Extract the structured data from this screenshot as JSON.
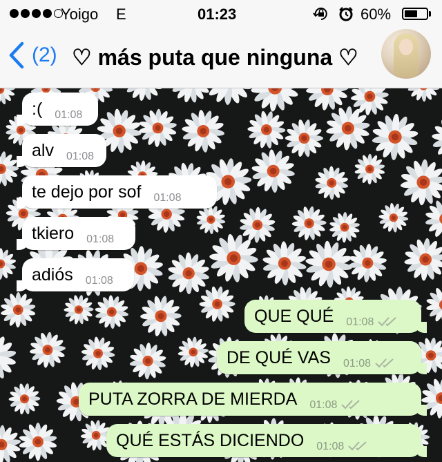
{
  "status_bar": {
    "carrier": "Yoigo",
    "network": "E",
    "time": "01:23",
    "battery": "60%",
    "battery_level": 0.6,
    "icons": [
      "signal-dots-icon",
      "rotation-lock-icon",
      "alarm-icon",
      "battery-icon"
    ]
  },
  "header": {
    "back_count": "(2)",
    "title": "♡ más puta que ninguna ♡",
    "icons": [
      "chevron-left-icon",
      "contact-avatar"
    ]
  },
  "colors": {
    "ios_blue": "#1b7cf2",
    "incoming_bubble": "#ffffff",
    "outgoing_bubble": "#dcf8c6",
    "timestamp_gray": "#8e8e93",
    "read_ticks": "#a9b5a2"
  },
  "messages": [
    {
      "direction": "in",
      "text": ":(",
      "time": "01:08"
    },
    {
      "direction": "in",
      "text": "alv",
      "time": "01:08"
    },
    {
      "direction": "in",
      "text": "te dejo por sof",
      "time": "01:08"
    },
    {
      "direction": "in",
      "text": "tkiero",
      "time": "01:08"
    },
    {
      "direction": "in",
      "text": "adiós",
      "time": "01:08"
    },
    {
      "direction": "out",
      "text": "QUE QUÉ",
      "time": "01:08",
      "status": "double-check-icon"
    },
    {
      "direction": "out",
      "text": "DE QUÉ VAS",
      "time": "01:08",
      "status": "double-check-icon"
    },
    {
      "direction": "out",
      "text": "PUTA ZORRA DE MIERDA",
      "time": "01:08",
      "status": "double-check-icon"
    },
    {
      "direction": "out",
      "text": "QUÉ ESTÁS DICIENDO",
      "time": "01:08",
      "status": "double-check-icon"
    }
  ]
}
